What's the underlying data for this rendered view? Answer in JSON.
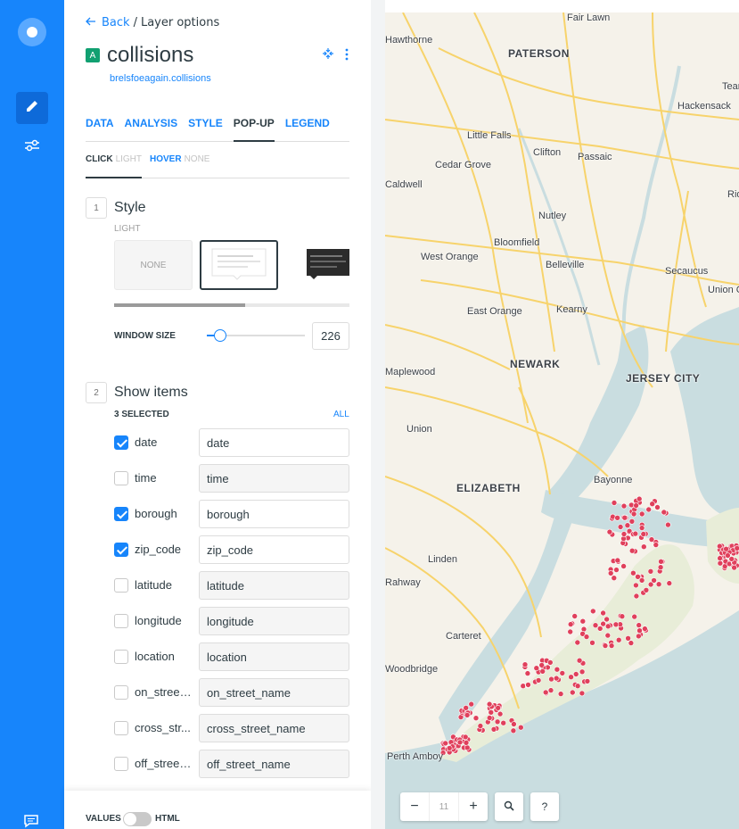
{
  "breadcrumb": {
    "back_label": "Back",
    "separator": "/",
    "current": "Layer options"
  },
  "layer": {
    "badge": "A",
    "name": "collisions",
    "dataset": "brelsfoeagain.collisions"
  },
  "tabs": [
    {
      "label": "DATA",
      "active": false
    },
    {
      "label": "ANALYSIS",
      "active": false
    },
    {
      "label": "STYLE",
      "active": false
    },
    {
      "label": "POP-UP",
      "active": true
    },
    {
      "label": "LEGEND",
      "active": false
    }
  ],
  "subtabs": {
    "click": {
      "label": "CLICK",
      "value": "LIGHT"
    },
    "hover": {
      "label": "HOVER",
      "value": "NONE"
    }
  },
  "style_section": {
    "number": "1",
    "title": "Style",
    "selected_label": "LIGHT",
    "none_label": "NONE",
    "window_size_label": "WINDOW SIZE",
    "window_size_value": "226"
  },
  "items_section": {
    "number": "2",
    "title": "Show items",
    "selected_count": "3 SELECTED",
    "all_label": "ALL",
    "items": [
      {
        "name": "date",
        "title": "date",
        "checked": true
      },
      {
        "name": "time",
        "title": "time",
        "checked": false
      },
      {
        "name": "borough",
        "title": "borough",
        "checked": true
      },
      {
        "name": "zip_code",
        "title": "zip_code",
        "checked": true
      },
      {
        "name": "latitude",
        "title": "latitude",
        "checked": false
      },
      {
        "name": "longitude",
        "title": "longitude",
        "checked": false
      },
      {
        "name": "location",
        "title": "location",
        "checked": false
      },
      {
        "name": "on_street...",
        "title": "on_street_name",
        "checked": false
      },
      {
        "name": "cross_str...",
        "title": "cross_street_name",
        "checked": false
      },
      {
        "name": "off_street...",
        "title": "off_street_name",
        "checked": false
      }
    ]
  },
  "footer": {
    "values_label": "VALUES",
    "html_label": "HTML"
  },
  "map": {
    "places": [
      "Fair Lawn",
      "Hawthorne",
      "PATERSON",
      "Teaneck",
      "Hackensack",
      "Ridgefield",
      "Little Falls",
      "Clifton",
      "Passaic",
      "Cedar Grove",
      "Caldwell",
      "Nutley",
      "Bloomfield",
      "Belleville",
      "West Orange",
      "Secaucus",
      "Union City",
      "East Orange",
      "Kearny",
      "Maplewood",
      "NEWARK",
      "JERSEY CITY",
      "Union",
      "Bayonne",
      "ELIZABETH",
      "Linden",
      "Rahway",
      "Carteret",
      "Woodbridge",
      "Perth Amboy"
    ],
    "zoom_level": "11",
    "zoom_out": "−",
    "zoom_in": "+",
    "help": "?",
    "colors": {
      "land": "#f5f2ea",
      "water": "#c9dde0",
      "road": "#f7d36b",
      "point": "#e0405c"
    }
  }
}
